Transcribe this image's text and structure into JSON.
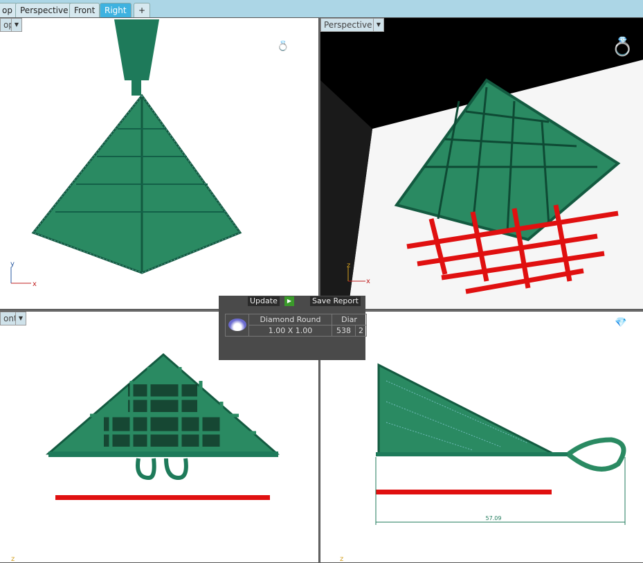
{
  "tabs": [
    {
      "label": "op"
    },
    {
      "label": "Perspective"
    },
    {
      "label": "Front"
    },
    {
      "label": "Right",
      "active": true
    },
    {
      "label": "+"
    }
  ],
  "viewports": {
    "top": {
      "label": "op",
      "axes": [
        "y",
        "x"
      ]
    },
    "perspective": {
      "label": "Perspective",
      "axes": [
        "z",
        "x"
      ]
    },
    "front": {
      "label": "ont",
      "axes": [
        "z"
      ]
    },
    "right": {
      "label": "",
      "axes": [
        "z"
      ],
      "dimension": "57.09"
    }
  },
  "panel": {
    "update_label": "Update",
    "save_label": "Save Report",
    "stone_name": "Diamond Round",
    "stone_size": "1.00 X 1.00",
    "col3_header": "Diar",
    "count": "538",
    "col4": "2"
  },
  "colors": {
    "model": "#1e7a5a",
    "support": "#e01010",
    "accent": "#3eb2e0"
  }
}
